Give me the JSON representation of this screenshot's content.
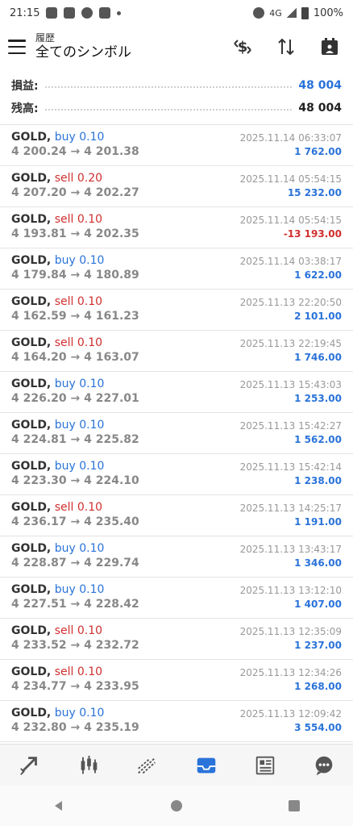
{
  "status_bar": {
    "time": "21:15",
    "network": "4G",
    "battery": "100%"
  },
  "header": {
    "subtitle": "履歴",
    "title": "全てのシンボル"
  },
  "summary": [
    {
      "label": "損益:",
      "value": "48 004",
      "color": "#2a73d9"
    },
    {
      "label": "残高:",
      "value": "48 004",
      "color": "#222222"
    }
  ],
  "trades": [
    {
      "symbol": "GOLD,",
      "side": "buy",
      "volume": "0.10",
      "prices": "4 200.24 → 4 201.38",
      "time": "2025.11.14 06:33:07",
      "profit": "1 762.00"
    },
    {
      "symbol": "GOLD,",
      "side": "sell",
      "volume": "0.20",
      "prices": "4 207.20 → 4 202.27",
      "time": "2025.11.14 05:54:15",
      "profit": "15 232.00"
    },
    {
      "symbol": "GOLD,",
      "side": "sell",
      "volume": "0.10",
      "prices": "4 193.81 → 4 202.35",
      "time": "2025.11.14 05:54:15",
      "profit": "-13 193.00"
    },
    {
      "symbol": "GOLD,",
      "side": "buy",
      "volume": "0.10",
      "prices": "4 179.84 → 4 180.89",
      "time": "2025.11.14 03:38:17",
      "profit": "1 622.00"
    },
    {
      "symbol": "GOLD,",
      "side": "sell",
      "volume": "0.10",
      "prices": "4 162.59 → 4 161.23",
      "time": "2025.11.13 22:20:50",
      "profit": "2 101.00"
    },
    {
      "symbol": "GOLD,",
      "side": "sell",
      "volume": "0.10",
      "prices": "4 164.20 → 4 163.07",
      "time": "2025.11.13 22:19:45",
      "profit": "1 746.00"
    },
    {
      "symbol": "GOLD,",
      "side": "buy",
      "volume": "0.10",
      "prices": "4 226.20 → 4 227.01",
      "time": "2025.11.13 15:43:03",
      "profit": "1 253.00"
    },
    {
      "symbol": "GOLD,",
      "side": "buy",
      "volume": "0.10",
      "prices": "4 224.81 → 4 225.82",
      "time": "2025.11.13 15:42:27",
      "profit": "1 562.00"
    },
    {
      "symbol": "GOLD,",
      "side": "buy",
      "volume": "0.10",
      "prices": "4 223.30 → 4 224.10",
      "time": "2025.11.13 15:42:14",
      "profit": "1 238.00"
    },
    {
      "symbol": "GOLD,",
      "side": "sell",
      "volume": "0.10",
      "prices": "4 236.17 → 4 235.40",
      "time": "2025.11.13 14:25:17",
      "profit": "1 191.00"
    },
    {
      "symbol": "GOLD,",
      "side": "buy",
      "volume": "0.10",
      "prices": "4 228.87 → 4 229.74",
      "time": "2025.11.13 13:43:17",
      "profit": "1 346.00"
    },
    {
      "symbol": "GOLD,",
      "side": "buy",
      "volume": "0.10",
      "prices": "4 227.51 → 4 228.42",
      "time": "2025.11.13 13:12:10",
      "profit": "1 407.00"
    },
    {
      "symbol": "GOLD,",
      "side": "sell",
      "volume": "0.10",
      "prices": "4 233.52 → 4 232.72",
      "time": "2025.11.13 12:35:09",
      "profit": "1 237.00"
    },
    {
      "symbol": "GOLD,",
      "side": "sell",
      "volume": "0.10",
      "prices": "4 234.77 → 4 233.95",
      "time": "2025.11.13 12:34:26",
      "profit": "1 268.00"
    },
    {
      "symbol": "GOLD,",
      "side": "buy",
      "volume": "0.10",
      "prices": "4 232.80 → 4 235.19",
      "time": "2025.11.13 12:09:42",
      "profit": "3 554.00"
    }
  ],
  "bottom_nav": [
    {
      "name": "quotes-nav",
      "icon": "trade-arrows-icon"
    },
    {
      "name": "chart-nav",
      "icon": "candlestick-icon"
    },
    {
      "name": "trade-nav",
      "icon": "trend-lines-icon"
    },
    {
      "name": "history-nav",
      "icon": "inbox-tray-icon",
      "active": true
    },
    {
      "name": "news-nav",
      "icon": "newspaper-icon"
    },
    {
      "name": "chat-nav",
      "icon": "chat-bubble-icon"
    }
  ],
  "colors": {
    "buy": "#2a73d9",
    "sell": "#d12f2f",
    "active_nav": "#2a73d9",
    "inactive_nav": "#555555"
  }
}
